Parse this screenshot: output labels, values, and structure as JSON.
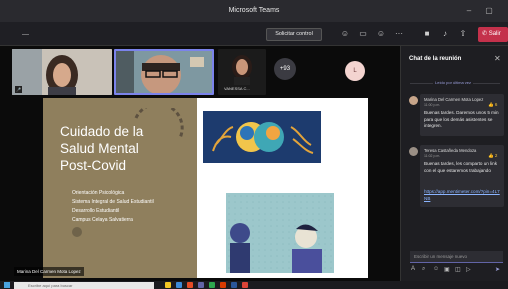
{
  "window": {
    "title": "Microsoft Teams"
  },
  "toolbar": {
    "timer": "—",
    "control_label": "Solicitar control",
    "leave_label": "Salir"
  },
  "participants": [
    {
      "name": ""
    },
    {
      "name": ""
    },
    {
      "name": "VANESSA C..."
    },
    {
      "name": "+93",
      "is_overflow": true
    },
    {
      "name": "L"
    }
  ],
  "slide": {
    "title_lines": [
      "Cuidado de la",
      "Salud Mental",
      "Post-Covid"
    ],
    "lines": [
      "Orientación Psicológica",
      "Sistema Integral de Salud Estudiantil",
      "Desarrollo Estudiantil",
      "Campus Celaya Salvatierra"
    ],
    "colors": {
      "left_panel": "#8f7f5d",
      "title_text": "#ffffff"
    }
  },
  "presenter": {
    "name": "Marina Del Carmen Mota Lopez"
  },
  "chat": {
    "title": "Chat de la reunión",
    "unread_divider": "Leído por última vez",
    "messages": [
      {
        "author": "Marina Del Carmen Mota Lopez",
        "time": "11:00 p.m.",
        "reactions": "6",
        "text": "Buenas tardes. Daremos unos 5 min para que los demás asistentes se integren."
      },
      {
        "author": "Teresa Castañeda Mendoza",
        "time": "11:02 p.m.",
        "reactions": "2",
        "text": "Buenas tardes, les comparto un link con el que estaremos trabajando",
        "link": "https://app.mentimeter.com/?pin=4L7NB"
      }
    ],
    "compose_placeholder": "Escribir un mensaje nuevo"
  },
  "taskbar": {
    "search_placeholder": "Escribe aquí para buscar"
  },
  "icons": {
    "minimize": "minimize-icon",
    "maximize": "maximize-icon",
    "people": "people-icon",
    "chat": "chat-icon",
    "reactions": "reactions-icon",
    "more": "more-icon",
    "camera": "camera-icon",
    "mic": "mic-icon",
    "share": "share-icon",
    "phone": "phone-icon"
  },
  "colors": {
    "accent": "#6264a7",
    "leave": "#c4314b"
  }
}
